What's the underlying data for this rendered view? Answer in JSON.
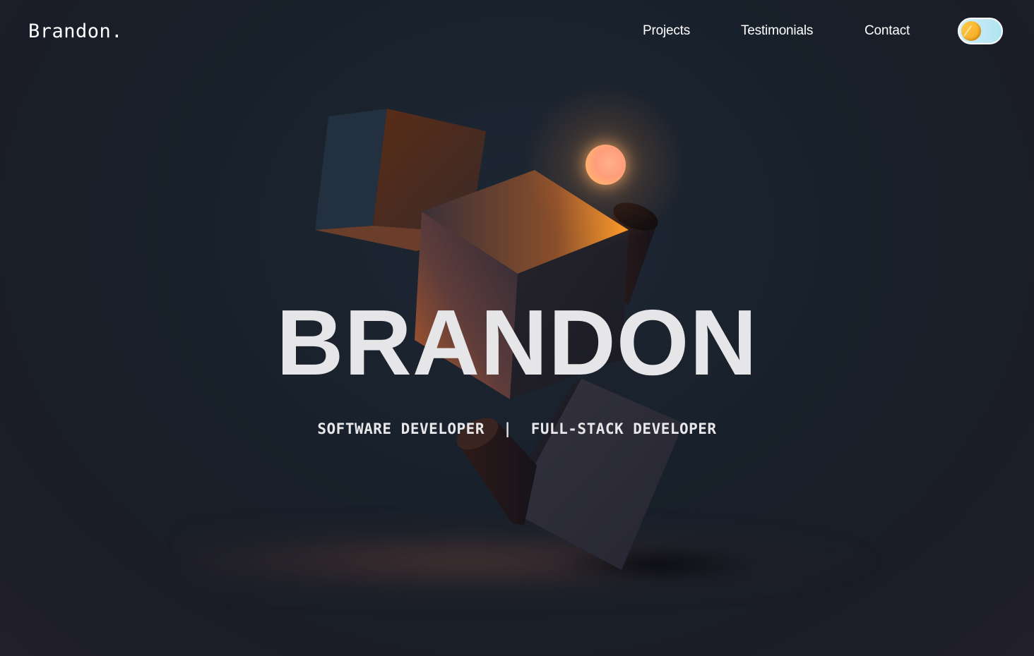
{
  "nav": {
    "logo": "Brandon.",
    "links": [
      "Projects",
      "Testimonials",
      "Contact"
    ],
    "theme_toggle_state": "light-mode"
  },
  "hero": {
    "title": "BRANDON",
    "subtitle_left": "SOFTWARE DEVELOPER",
    "separator": "|",
    "subtitle_right": "FULL-STACK DEVELOPER"
  },
  "colors": {
    "background": "#18202b",
    "accent_orange": "#ff9d3a",
    "toggle_track": "#aee4f2",
    "toggle_knob": "#f4a71d"
  }
}
